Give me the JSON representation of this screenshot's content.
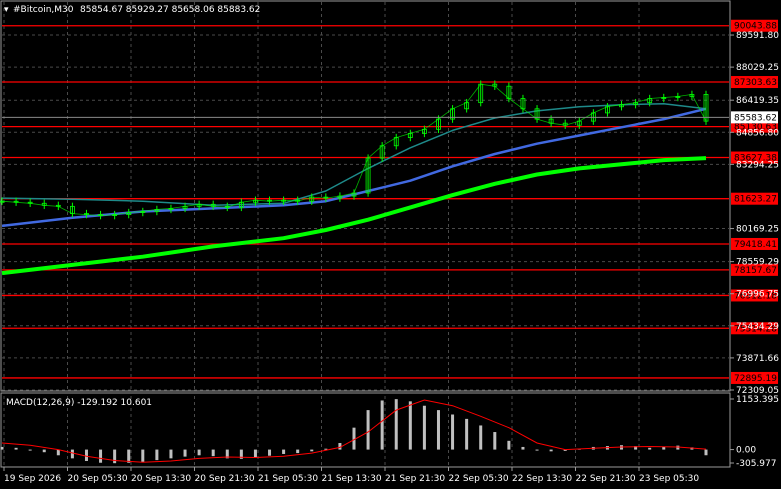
{
  "header": {
    "symbol": "#Bitcoin,M30",
    "ohlc": "85854.67 85929.27 85658.06 85883.62"
  },
  "colors": {
    "background": "#000000",
    "grid": "#4a4a4a",
    "candle": "#00ff00",
    "level": "#ff0000",
    "level_label_bg": "#ff0000",
    "ma_fast": "#1e8a8a",
    "ma_mid": "#4169e1",
    "ma_slow": "#00ff00",
    "macd_hist": "#c0c0c0",
    "macd_signal": "#ff0000",
    "axis_text": "#ffffff"
  },
  "chart_data": [
    {
      "type": "line",
      "panel": "price",
      "title": "#Bitcoin,M30",
      "ylim": [
        72309.05,
        91200
      ],
      "y_ticks": [
        "89591.80",
        "88029.25",
        "86419.35",
        "84856.80",
        "83294.25",
        "80169.25",
        "78559.29",
        "76996.75",
        "75434.29",
        "73871.66",
        "72309.05"
      ],
      "x_ticks": [
        "19 Sep 2026",
        "20 Sep 05:30",
        "20 Sep 13:30",
        "20 Sep 21:30",
        "21 Sep 05:30",
        "21 Sep 13:30",
        "21 Sep 21:30",
        "22 Sep 05:30",
        "22 Sep 13:30",
        "22 Sep 21:30",
        "23 Sep 05:30"
      ],
      "current_price": "85583.62",
      "horizontal_levels": [
        "90043.88",
        "87303.63",
        "85130.63",
        "83627.38",
        "81623.27",
        "79418.41",
        "78157.67",
        "76912.18",
        "75314.28",
        "72895.19"
      ],
      "series": [
        {
          "kind": "price",
          "x": [
            0,
            2,
            4,
            6,
            8,
            10,
            12,
            14,
            16,
            18,
            20,
            22,
            24,
            26,
            28,
            30,
            32,
            34,
            36,
            38,
            40,
            42,
            44,
            46,
            48,
            50,
            52,
            54,
            56,
            58,
            60,
            62,
            64,
            66,
            68,
            70,
            72,
            74,
            76,
            78,
            80,
            82,
            84,
            86,
            88,
            90,
            92,
            94,
            96,
            98,
            100
          ],
          "values": [
            81500,
            81450,
            81400,
            81300,
            81250,
            80900,
            80850,
            80800,
            80850,
            80950,
            81000,
            81100,
            81150,
            81250,
            81350,
            81250,
            81200,
            81450,
            81550,
            81500,
            81550,
            81500,
            81700,
            81650,
            81750,
            81900,
            83600,
            84200,
            84600,
            84800,
            85000,
            85500,
            86000,
            86300,
            87200,
            87100,
            86500,
            86000,
            85500,
            85300,
            85200,
            85400,
            85800,
            86100,
            86200,
            86300,
            86500,
            86550,
            86600,
            86700,
            85400
          ]
        },
        {
          "name": "",
          "kind": "ma_fast",
          "x": [
            0,
            10,
            20,
            30,
            40,
            46,
            52,
            58,
            64,
            70,
            76,
            82,
            88,
            94,
            100
          ],
          "values": [
            81650,
            81600,
            81500,
            81300,
            81400,
            82000,
            83100,
            84100,
            84950,
            85550,
            85900,
            86100,
            86200,
            86250,
            86000
          ]
        },
        {
          "name": "",
          "kind": "ma_mid",
          "x": [
            0,
            10,
            20,
            30,
            40,
            46,
            52,
            58,
            64,
            70,
            76,
            82,
            88,
            94,
            100
          ],
          "values": [
            80300,
            80700,
            81000,
            81150,
            81300,
            81500,
            82000,
            82500,
            83200,
            83800,
            84300,
            84700,
            85100,
            85500,
            86000
          ]
        },
        {
          "name": "",
          "kind": "ma_slow",
          "x": [
            0,
            10,
            20,
            30,
            40,
            46,
            52,
            58,
            64,
            70,
            76,
            82,
            88,
            94,
            100
          ],
          "values": [
            78000,
            78400,
            78800,
            79300,
            79700,
            80100,
            80600,
            81200,
            81800,
            82350,
            82800,
            83100,
            83300,
            83500,
            83600
          ]
        }
      ]
    },
    {
      "type": "bar",
      "panel": "macd",
      "title": "MACD(12,26,9) -129.192 10.601",
      "ylim": [
        -305.977,
        1153.395
      ],
      "y_ticks": [
        "1153.395",
        "0.00",
        "-305.977"
      ],
      "x": [
        0,
        2,
        4,
        6,
        8,
        10,
        12,
        14,
        16,
        18,
        20,
        22,
        24,
        26,
        28,
        30,
        32,
        34,
        36,
        38,
        40,
        42,
        44,
        46,
        48,
        50,
        52,
        54,
        56,
        58,
        60,
        62,
        64,
        66,
        68,
        70,
        72,
        74,
        76,
        78,
        80,
        82,
        84,
        86,
        88,
        90,
        92,
        94,
        96,
        98,
        100
      ],
      "values": [
        60,
        40,
        0,
        -60,
        -130,
        -200,
        -260,
        -300,
        -310,
        -300,
        -280,
        -240,
        -200,
        -160,
        -130,
        -150,
        -200,
        -210,
        -180,
        -140,
        -100,
        -80,
        -40,
        20,
        150,
        500,
        900,
        1120,
        1150,
        1100,
        1000,
        900,
        800,
        700,
        550,
        400,
        200,
        60,
        0,
        -40,
        -30,
        20,
        60,
        80,
        100,
        80,
        40,
        60,
        90,
        50,
        -129.192
      ],
      "series": [
        {
          "name": "",
          "kind": "signal",
          "x": [
            0,
            4,
            8,
            12,
            16,
            20,
            24,
            28,
            32,
            36,
            40,
            44,
            48,
            52,
            56,
            60,
            64,
            68,
            72,
            76,
            80,
            84,
            88,
            92,
            96,
            100
          ],
          "values": [
            150,
            100,
            0,
            -150,
            -250,
            -290,
            -260,
            -200,
            -170,
            -180,
            -150,
            -80,
            50,
            400,
            900,
            1130,
            1000,
            760,
            500,
            150,
            0,
            30,
            60,
            70,
            60,
            10.601
          ]
        }
      ]
    }
  ]
}
